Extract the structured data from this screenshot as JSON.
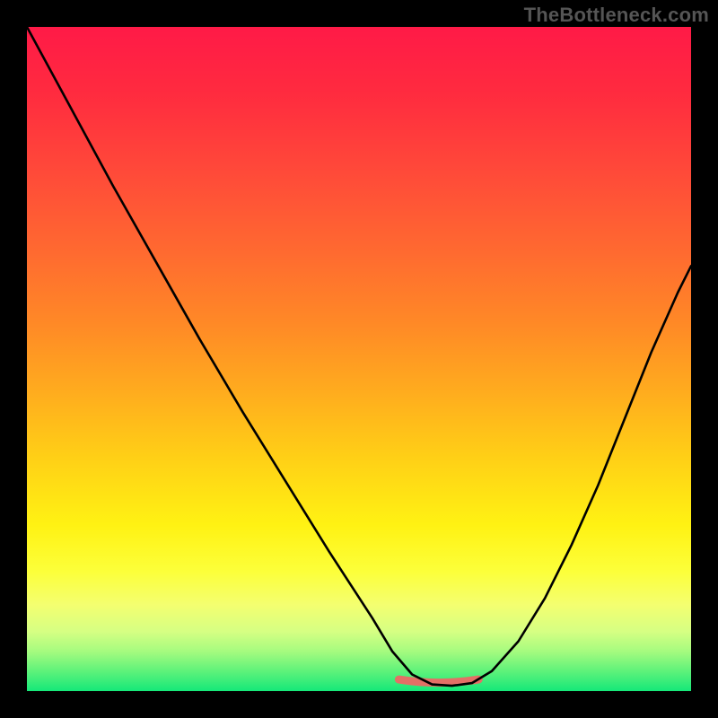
{
  "watermark": "TheBottleneck.com",
  "colors": {
    "frame_background": "#000000",
    "watermark_text": "#555555",
    "curve_stroke": "#000000",
    "highlight_segment": "#e37066",
    "gradient_stops": [
      "#ff1a47",
      "#ff2b3f",
      "#ff4a39",
      "#ff6a30",
      "#ff8a26",
      "#ffac1e",
      "#ffd016",
      "#fff213",
      "#fcff3a",
      "#f4ff70",
      "#d6ff83",
      "#a6fb7f",
      "#5ef27a",
      "#15e879"
    ]
  },
  "chart_data": {
    "type": "line",
    "title": "",
    "xlabel": "",
    "ylabel": "",
    "xlim": [
      0,
      100
    ],
    "ylim": [
      0,
      100
    ],
    "grid": false,
    "notes": "No axis ticks or numeric labels are visible; x/y values are fractional positions (0-100) estimated from the plotted curve. Lower y = better (curve reaches a minimum plateau near x 58-67). A salmon-colored highlight marks that minimum-plateau region.",
    "series": [
      {
        "name": "bottleneck-curve",
        "x": [
          0,
          6.5,
          13,
          19.5,
          26,
          32.5,
          39,
          45.5,
          52,
          55,
          58,
          61,
          64,
          67,
          70,
          74,
          78,
          82,
          86,
          90,
          94,
          98,
          100
        ],
        "y": [
          100,
          88,
          76,
          64.5,
          53,
          42,
          31.5,
          21,
          11,
          6,
          2.5,
          1,
          0.8,
          1.2,
          3,
          7.5,
          14,
          22,
          31,
          41,
          51,
          60,
          64
        ]
      }
    ],
    "highlight_segment": {
      "name": "optimal-range",
      "x_start": 56,
      "x_end": 68,
      "y": 1.2
    }
  }
}
